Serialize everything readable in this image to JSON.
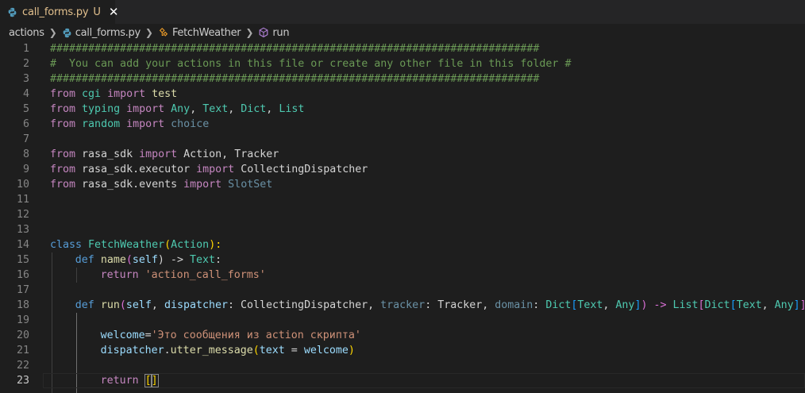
{
  "tab": {
    "filename": "call_forms.py",
    "status": "U",
    "close": "✕"
  },
  "breadcrumb": {
    "folder": "actions",
    "file": "call_forms.py",
    "class": "FetchWeather",
    "method": "run"
  },
  "editor": {
    "current_line": 23,
    "line_numbers": [
      "1",
      "2",
      "3",
      "4",
      "5",
      "6",
      "7",
      "8",
      "9",
      "10",
      "11",
      "12",
      "13",
      "14",
      "15",
      "16",
      "17",
      "18",
      "19",
      "20",
      "21",
      "22",
      "23"
    ],
    "lines": {
      "l1": "#############################################################################",
      "l2": "#  You can add your actions in this file or create any other file in this folder #",
      "l3": "#############################################################################",
      "l4": [
        "from",
        " ",
        "cgi",
        " ",
        "import",
        " ",
        "test"
      ],
      "l5": [
        "from",
        " ",
        "typing",
        " ",
        "import",
        " ",
        "Any",
        ", ",
        "Text",
        ", ",
        "Dict",
        ", ",
        "List"
      ],
      "l6": [
        "from",
        " ",
        "random",
        " ",
        "import",
        " ",
        "choice"
      ],
      "l8": [
        "from",
        " rasa_sdk ",
        "import",
        " Action, Tracker"
      ],
      "l9": [
        "from",
        " rasa_sdk.executor ",
        "import",
        " CollectingDispatcher"
      ],
      "l10": [
        "from",
        " rasa_sdk.events ",
        "import",
        " SlotSet"
      ],
      "l14": [
        "class",
        " ",
        "FetchWeather",
        "(",
        "Action",
        "):"
      ],
      "l15": [
        "def",
        " ",
        "name",
        "(",
        "self",
        ") -> ",
        "Text",
        ":"
      ],
      "l16": [
        "return",
        " ",
        "'action_call_forms'"
      ],
      "l18": [
        "def",
        " ",
        "run",
        "(",
        "self",
        ", ",
        "dispatcher",
        ": CollectingDispatcher, ",
        "tracker",
        ": Tracker, ",
        "domain",
        ": ",
        "Dict",
        "[",
        "Text",
        ", ",
        "Any",
        "]",
        ") -> ",
        "List",
        "[",
        "Dict",
        "[",
        "Text",
        ", ",
        "Any",
        "]",
        "]",
        ":"
      ],
      "l20": [
        "welcome",
        "=",
        "'Это сообщения из action скрипта'"
      ],
      "l21": [
        "dispatcher",
        ".",
        "utter_message",
        "(",
        "text",
        " = ",
        "welcome",
        ")"
      ],
      "l23": [
        "return",
        " ",
        "[",
        "]"
      ]
    }
  },
  "colors": {
    "background": "#1e1e1e",
    "comment": "#6a9955",
    "keyword_control": "#c586c0",
    "keyword": "#569cd6",
    "class": "#4ec9b0",
    "variable": "#9cdcfe",
    "function": "#dcdcaa",
    "string": "#ce9178",
    "modified_tab": "#e2c08d"
  },
  "icons": {
    "tab_icon": "python-file-icon",
    "breadcrumb_file_icon": "python-file-icon",
    "breadcrumb_class_icon": "class-symbol-icon",
    "breadcrumb_method_icon": "method-symbol-icon"
  }
}
